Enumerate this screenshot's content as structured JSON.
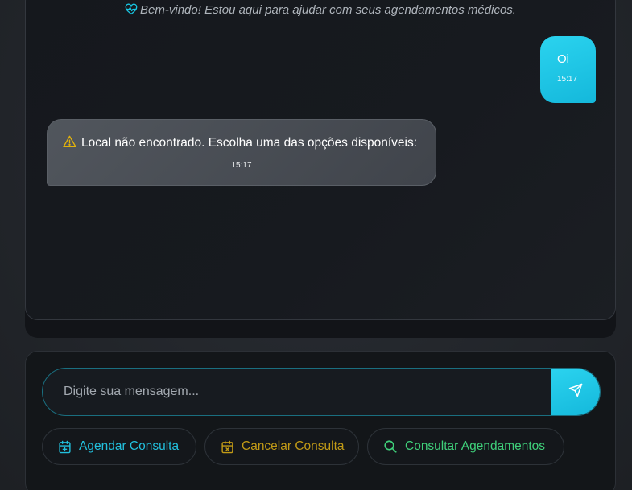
{
  "chat": {
    "welcome_icon": "heart-pulse-icon",
    "welcome_text": "Bem-vindo! Estou aqui para ajudar com seus agendamentos médicos.",
    "messages": [
      {
        "sender": "user",
        "text": "Oi",
        "time": "15:17"
      },
      {
        "sender": "bot",
        "icon": "warning-icon",
        "text": "Local não encontrado. Escolha uma das opções disponíveis:",
        "time": "15:17"
      }
    ]
  },
  "input": {
    "placeholder": "Digite sua mensagem...",
    "value": "",
    "send_icon": "send-icon"
  },
  "quick_actions": [
    {
      "label": "Agendar Consulta",
      "icon": "calendar-plus-icon",
      "color": "#22c0dd"
    },
    {
      "label": "Cancelar Consulta",
      "icon": "calendar-x-icon",
      "color": "#c29b16"
    },
    {
      "label": "Consultar Agendamentos",
      "icon": "search-icon",
      "color": "#3fd07a"
    }
  ],
  "colors": {
    "accent": "#18c5e2",
    "background": "#212429",
    "panel": "#15181d"
  }
}
